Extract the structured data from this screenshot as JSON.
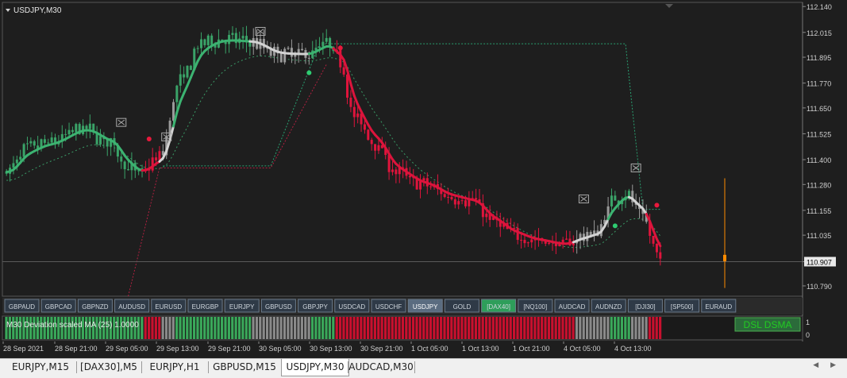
{
  "symbol_label": "USDJPY,M30",
  "price_axis": [
    "112.140",
    "112.015",
    "111.895",
    "111.770",
    "111.650",
    "111.525",
    "111.400",
    "111.280",
    "111.155",
    "111.035",
    "110.907",
    "110.790"
  ],
  "current_price": "110.907",
  "time_axis": [
    "28 Sep 2021",
    "28 Sep 21:00",
    "29 Sep 05:00",
    "29 Sep 13:00",
    "29 Sep 21:00",
    "30 Sep 05:00",
    "30 Sep 13:00",
    "30 Sep 21:00",
    "1 Oct 05:00",
    "1 Oct 13:00",
    "1 Oct 21:00",
    "4 Oct 05:00",
    "4 Oct 13:00"
  ],
  "symbol_buttons": [
    "GBPAUD",
    "GBPCAD",
    "GBPNZD",
    "AUDUSD",
    "EURUSD",
    "EURGBP",
    "EURJPY",
    "GBPUSD",
    "GBPJPY",
    "USDCAD",
    "USDCHF",
    "USDJPY",
    "GOLD",
    "[DAX40]",
    "[NQ100]",
    "AUDCAD",
    "AUDNZD",
    "[DJI30]",
    "[SP500]",
    "EURAUD"
  ],
  "active_symbol": "USDJPY",
  "highlight_symbol": "[DAX40]",
  "sub_indicator": {
    "label": "M30 Deviation scaled MA (25) 1.0000",
    "badge": "DSL DSMA",
    "scale": [
      "1",
      "0"
    ]
  },
  "bottom_tabs": [
    "EURJPY,M15",
    "[DAX30],M5",
    "EURJPY,H1",
    "GBPUSD,M15",
    "USDJPY,M30",
    "AUDCAD,M30"
  ],
  "active_tab": "USDJPY,M30",
  "colors": {
    "background": "#1e1e1e",
    "up_candle": "#3aa368",
    "down_candle": "#e0143c",
    "neutral_candle": "#9a9a9a",
    "dsma_up": "#3cb371",
    "dsma_down": "#dc143c",
    "dsma_neutral": "#d3d3d3",
    "axis_text": "#cfcfcf",
    "badge_text": "#22cc22"
  },
  "chart_data": {
    "type": "candlestick",
    "symbol": "USDJPY",
    "timeframe": "M30",
    "ylim": [
      110.74,
      112.16
    ],
    "grid": false,
    "path_anchors": [
      {
        "bar": 0,
        "price": 111.34
      },
      {
        "bar": 6,
        "price": 111.45
      },
      {
        "bar": 12,
        "price": 111.48
      },
      {
        "bar": 22,
        "price": 111.55
      },
      {
        "bar": 30,
        "price": 111.48
      },
      {
        "bar": 35,
        "price": 111.36
      },
      {
        "bar": 38,
        "price": 111.33
      },
      {
        "bar": 44,
        "price": 111.41
      },
      {
        "bar": 50,
        "price": 111.78
      },
      {
        "bar": 56,
        "price": 111.96
      },
      {
        "bar": 62,
        "price": 111.98
      },
      {
        "bar": 70,
        "price": 111.97
      },
      {
        "bar": 78,
        "price": 111.91
      },
      {
        "bar": 86,
        "price": 111.91
      },
      {
        "bar": 92,
        "price": 111.96
      },
      {
        "bar": 96,
        "price": 111.88
      },
      {
        "bar": 100,
        "price": 111.6
      },
      {
        "bar": 106,
        "price": 111.48
      },
      {
        "bar": 112,
        "price": 111.34
      },
      {
        "bar": 120,
        "price": 111.28
      },
      {
        "bar": 128,
        "price": 111.22
      },
      {
        "bar": 134,
        "price": 111.2
      },
      {
        "bar": 140,
        "price": 111.1
      },
      {
        "bar": 146,
        "price": 111.04
      },
      {
        "bar": 152,
        "price": 111.01
      },
      {
        "bar": 160,
        "price": 110.99
      },
      {
        "bar": 166,
        "price": 111.03
      },
      {
        "bar": 170,
        "price": 111.05
      },
      {
        "bar": 174,
        "price": 111.2
      },
      {
        "bar": 178,
        "price": 111.24
      },
      {
        "bar": 182,
        "price": 111.15
      },
      {
        "bar": 188,
        "price": 110.92
      }
    ],
    "bar_count": 189,
    "signals": {
      "cross_markers": [
        {
          "bar": 33,
          "price": 111.58
        },
        {
          "bar": 46,
          "price": 111.51
        },
        {
          "bar": 73,
          "price": 112.02
        },
        {
          "bar": 166,
          "price": 111.21
        },
        {
          "bar": 181,
          "price": 111.36
        }
      ],
      "buy_dots": [
        {
          "bar": 87,
          "price": 111.82
        },
        {
          "bar": 175,
          "price": 111.08
        }
      ],
      "sell_dots": [
        {
          "bar": 41,
          "price": 111.5
        },
        {
          "bar": 96,
          "price": 111.94
        },
        {
          "bar": 187,
          "price": 111.18
        }
      ]
    },
    "subwindow_segments": [
      {
        "from": 0,
        "to": 40,
        "state": "up"
      },
      {
        "from": 40,
        "to": 45,
        "state": "down"
      },
      {
        "from": 45,
        "to": 49,
        "state": "neutral"
      },
      {
        "from": 49,
        "to": 71,
        "state": "up"
      },
      {
        "from": 71,
        "to": 88,
        "state": "neutral"
      },
      {
        "from": 88,
        "to": 95,
        "state": "up"
      },
      {
        "from": 95,
        "to": 164,
        "state": "down"
      },
      {
        "from": 164,
        "to": 174,
        "state": "neutral"
      },
      {
        "from": 174,
        "to": 180,
        "state": "up"
      },
      {
        "from": 180,
        "to": 185,
        "state": "neutral"
      },
      {
        "from": 185,
        "to": 189,
        "state": "down"
      }
    ]
  }
}
